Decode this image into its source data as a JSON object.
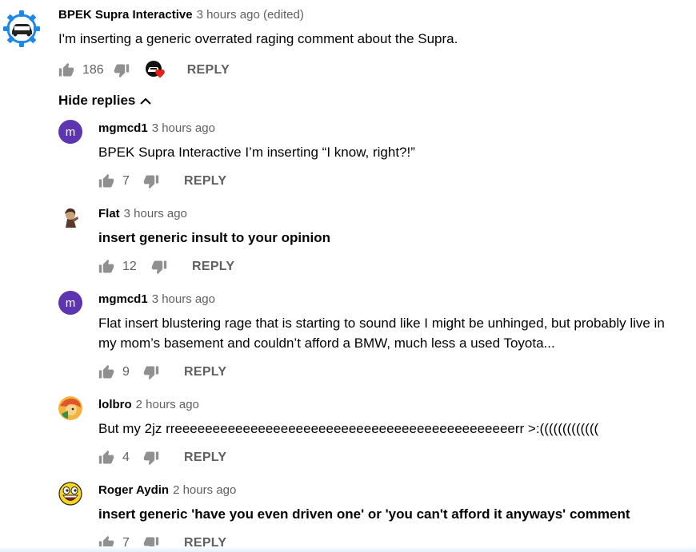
{
  "colors": {
    "avatar_purple": "#5e35b1",
    "heart": "#e62117",
    "meta_gray": "#606060",
    "text": "#030303"
  },
  "main_comment": {
    "author": "BPEK Supra Interactive",
    "time": "3 hours ago (edited)",
    "text": "I'm inserting a generic overrated raging comment about the Supra.",
    "likes": "186",
    "reply_label": "REPLY",
    "avatar_icon": "gear-car-logo-icon",
    "creator_heart_icon": "heart-icon"
  },
  "hide_replies": {
    "label": "Hide replies"
  },
  "replies": [
    {
      "author": "mgmcd1",
      "time": "3 hours ago",
      "text": "BPEK Supra Interactive I’m inserting “I know, right?!”",
      "likes": "7",
      "reply_label": "REPLY",
      "avatar_letter": "m"
    },
    {
      "author": "Flat",
      "time": "3 hours ago",
      "text": "insert generic insult to your opinion",
      "likes": "12",
      "reply_label": "REPLY",
      "avatar_icon": "character-avatar-icon"
    },
    {
      "author": "mgmcd1",
      "time": "3 hours ago",
      "text": "Flat insert blustering rage that is starting to sound like I might be unhinged, but probably live in my mom’s basement and couldn’t afford a BMW, much less a used Toyota...",
      "likes": "9",
      "reply_label": "REPLY",
      "avatar_letter": "m"
    },
    {
      "author": "lolbro",
      "time": "2 hours ago",
      "text": "But my 2jz rreeeeeeeeeeeeeeeeeeeeeeeeeeeeeeeeeeeeeeeeeeeeerr >:(((((((((((((",
      "likes": "4",
      "reply_label": "REPLY",
      "avatar_icon": "cartoon-avatar-icon"
    },
    {
      "author": "Roger Aydin",
      "time": "2 hours ago",
      "text": "insert generic 'have you even driven one' or 'you can't afford it anyways' comment",
      "likes": "7",
      "reply_label": "REPLY",
      "avatar_icon": "awesome-face-icon"
    }
  ]
}
